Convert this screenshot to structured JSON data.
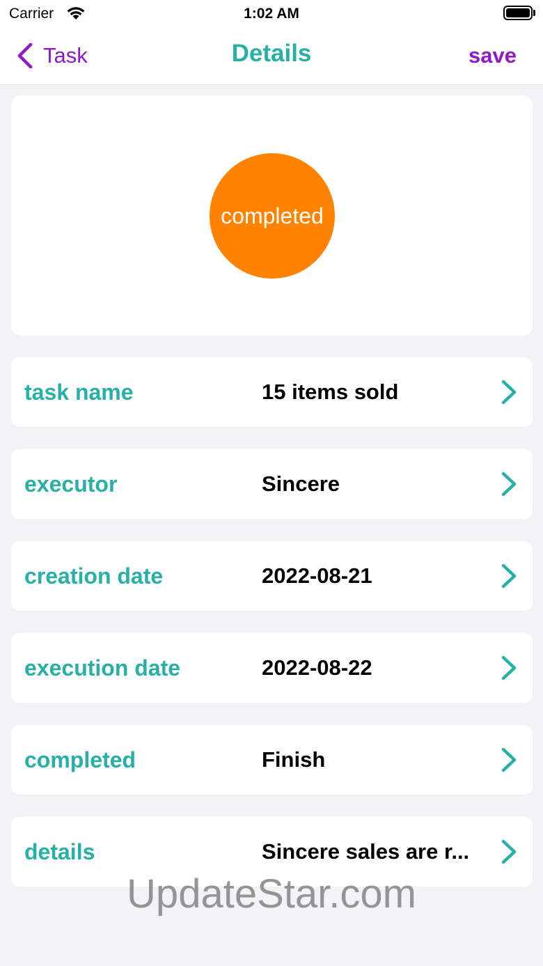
{
  "status_bar": {
    "carrier": "Carrier",
    "time": "1:02 AM"
  },
  "nav": {
    "back_label": "Task",
    "title": "Details",
    "save_label": "save"
  },
  "status": {
    "label": "completed",
    "color": "#ff8200"
  },
  "rows": [
    {
      "label": "task name",
      "value": "15 items sold"
    },
    {
      "label": "executor",
      "value": "Sincere"
    },
    {
      "label": "creation date",
      "value": "2022-08-21"
    },
    {
      "label": "execution date",
      "value": "2022-08-22"
    },
    {
      "label": "completed",
      "value": "Finish"
    },
    {
      "label": "details",
      "value": "Sincere sales are r..."
    }
  ],
  "watermark": "UpdateStar.com",
  "colors": {
    "accent_teal": "#27b0a6",
    "accent_purple": "#9118c9",
    "background": "#f2f2f7"
  },
  "icons": {
    "back": "chevron-left-icon",
    "row": "chevron-right-icon",
    "wifi": "wifi-icon",
    "battery": "battery-icon"
  }
}
